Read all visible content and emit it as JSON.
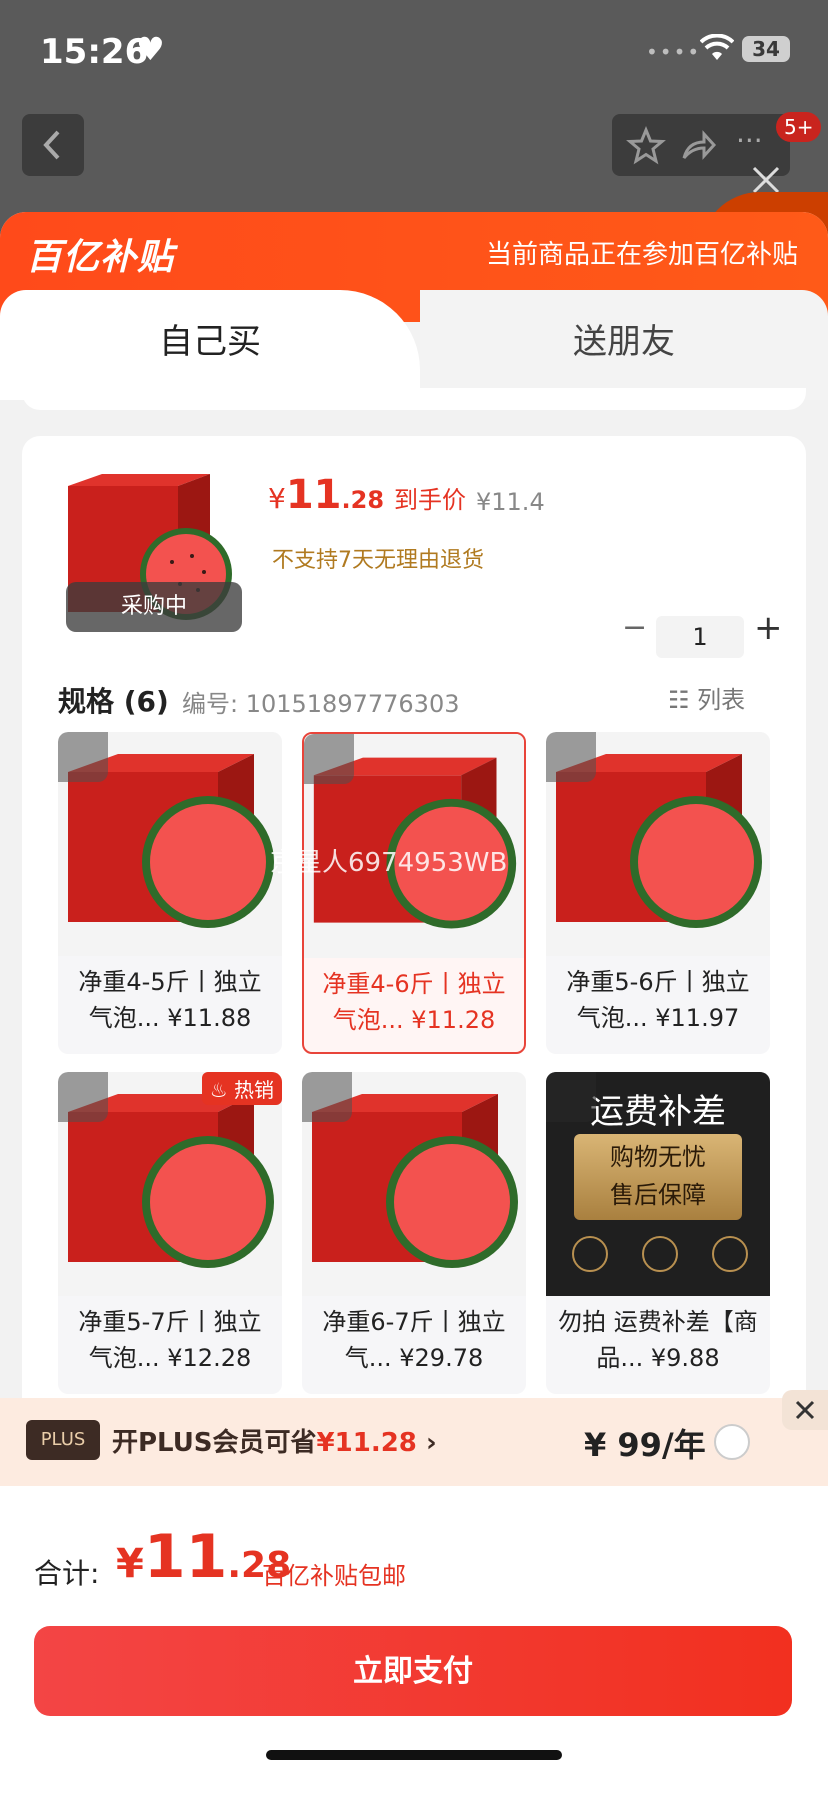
{
  "status": {
    "time": "15:26",
    "battery": "34",
    "notify_badge": "5+"
  },
  "banner": {
    "brand": "百亿补贴",
    "text": "当前商品正在参加百亿补贴"
  },
  "tabs": [
    "自己买",
    "送朋友"
  ],
  "product": {
    "currency": "¥",
    "price_int": "11",
    "price_dec": ".28",
    "price_tag": "到手价",
    "orig_price": "¥11.4",
    "no_return": "不支持7天无理由退货",
    "image_tag": "采购中",
    "qty": "1",
    "minus": "−",
    "plus": "+"
  },
  "spec": {
    "title": "规格 (6)",
    "number": "编号: 10151897776303",
    "list_toggle": "列表",
    "items": [
      {
        "label": "净重4-5斤丨独立气泡... ¥11.88",
        "selected": false,
        "hot": false
      },
      {
        "label": "净重4-6斤丨独立气泡... ¥11.28",
        "selected": true,
        "hot": false
      },
      {
        "label": "净重5-6斤丨独立气泡... ¥11.97",
        "selected": false,
        "hot": false
      },
      {
        "label": "净重5-7斤丨独立气泡... ¥12.28",
        "selected": false,
        "hot": true
      },
      {
        "label": "净重6-7斤丨独立气... ¥29.78",
        "selected": false,
        "hot": false
      },
      {
        "label": "勿拍 运费补差【商品... ¥9.88",
        "selected": false,
        "hot": false
      }
    ],
    "hot_label": "热销",
    "shipping_tile": {
      "title": "运费补差",
      "line1": "购物无忧",
      "line2": "售后保障"
    },
    "watermark": "京星人6974953WB"
  },
  "plus_bar": {
    "tag": "PLUS",
    "text_prefix": "开PLUS会员可省",
    "text_amount": "¥11.28",
    "chevron": "›",
    "price": "¥ 99/年"
  },
  "total": {
    "label": "合计:",
    "currency": "¥",
    "int": "11",
    "dec": ".28",
    "note": "百亿补贴包邮"
  },
  "pay_button": "立即支付",
  "colors": {
    "accent": "#e53322",
    "banner": "#ff4a1a"
  }
}
